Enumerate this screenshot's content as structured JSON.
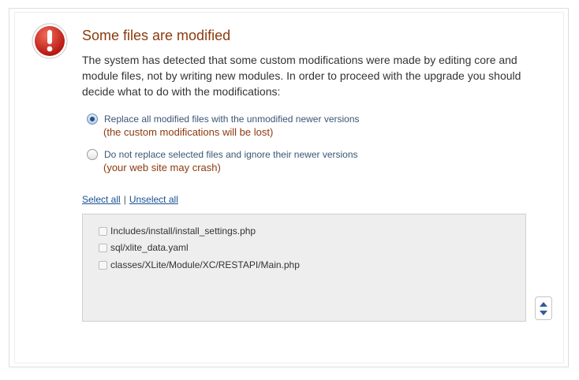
{
  "dialog": {
    "title": "Some files are modified",
    "description": "The system has detected that some custom modifications were made by editing core and module files, not by writing new modules. In order to proceed with the upgrade you should decide what to do with the modifications:",
    "icon": "warning-exclamation-icon",
    "colors": {
      "title": "#8b3a0e",
      "link": "#1a4f92",
      "warning": "#8b3a0e"
    }
  },
  "options": [
    {
      "label": "Replace all modified files with the unmodified newer versions",
      "warning": "(the custom modifications will be lost)",
      "checked": true
    },
    {
      "label": "Do not replace selected files and ignore their newer versions",
      "warning": "(your web site may crash)",
      "checked": false
    }
  ],
  "selection": {
    "select_all": "Select all",
    "separator": "|",
    "unselect_all": "Unselect all"
  },
  "files": [
    {
      "path": "Includes/install/install_settings.php",
      "checked": false
    },
    {
      "path": "sql/xlite_data.yaml",
      "checked": false
    },
    {
      "path": "classes/XLite/Module/XC/RESTAPI/Main.php",
      "checked": false
    }
  ]
}
